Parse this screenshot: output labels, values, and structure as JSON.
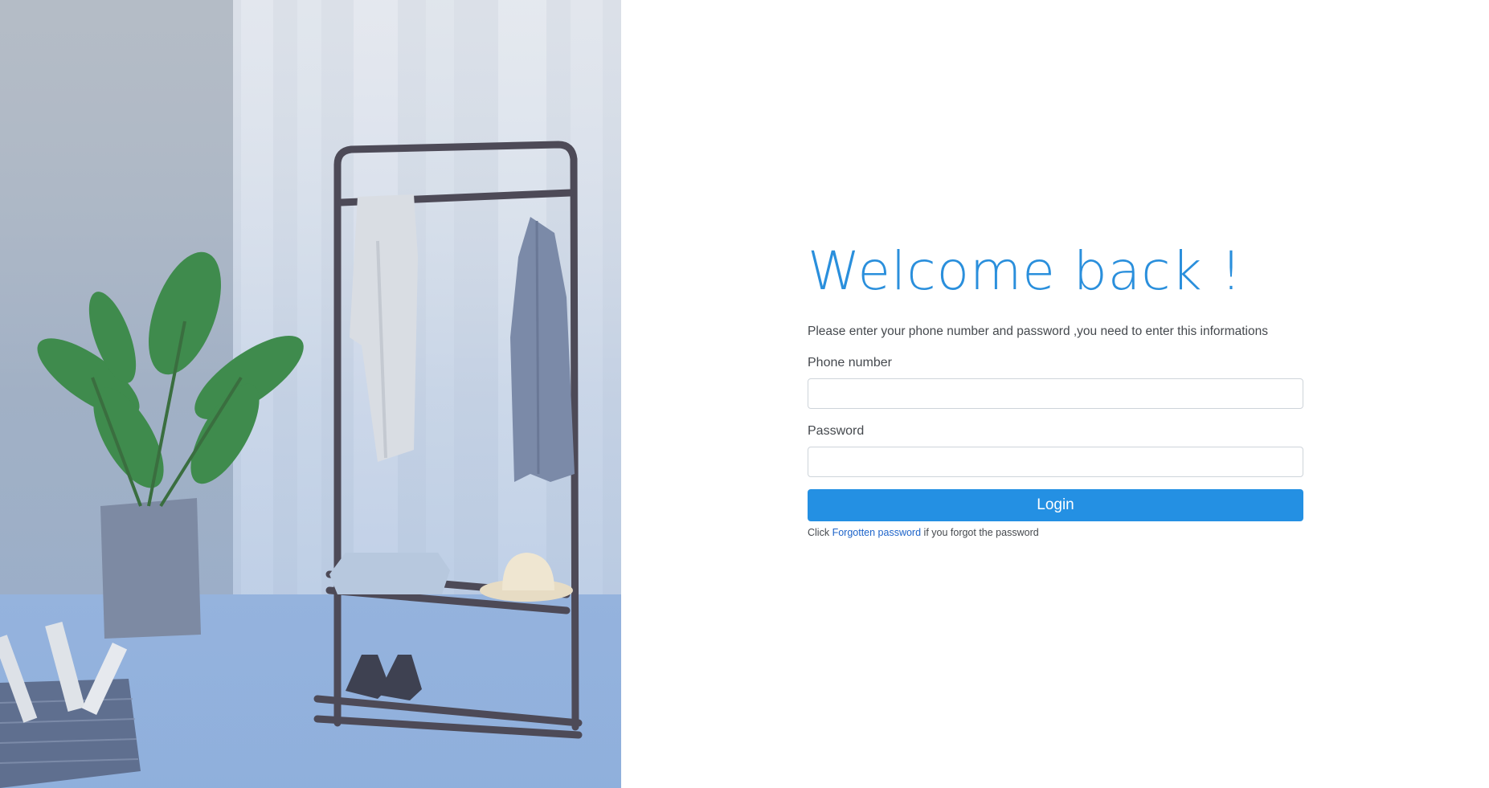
{
  "login": {
    "title": "Welcome back !",
    "intro": "Please enter your phone number and password ,you need to enter this informations",
    "phone_label": "Phone number",
    "phone_value": "",
    "password_label": "Password",
    "password_value": "",
    "login_button": "Login",
    "help_prefix": "Click",
    "help_link": "Forgotten password",
    "help_suffix": "if you forgot the password"
  },
  "colors": {
    "accent": "#2490e3",
    "title": "#2a8fdc",
    "link": "#1c63c9",
    "text": "#45494e"
  },
  "hero": {
    "icon": "clothes-rack-photo"
  }
}
